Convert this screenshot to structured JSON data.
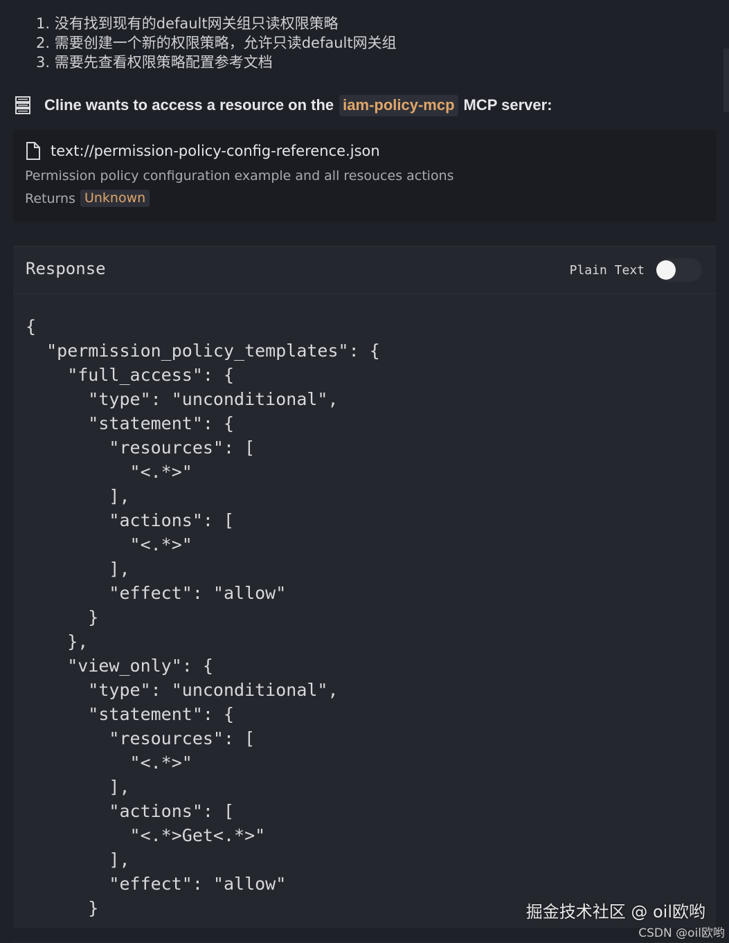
{
  "steps": [
    "1. 没有找到现有的default网关组只读权限策略",
    "2. 需要创建一个新的权限策略，允许只读default网关组",
    "3. 需要先查看权限策略配置参考文档"
  ],
  "access_header": {
    "icon": "server-icon",
    "prefix": "Cline wants to access a resource on the",
    "server_name": "iam-policy-mcp",
    "suffix": "MCP server:"
  },
  "resource": {
    "icon": "file-icon",
    "uri": "text://permission-policy-config-reference.json",
    "description": "Permission policy configuration example and all resouces actions",
    "returns_label": "Returns",
    "returns_value": "Unknown"
  },
  "response": {
    "title": "Response",
    "plain_text_label": "Plain Text",
    "plain_text_enabled": false,
    "code_lines": [
      "{",
      "  \"permission_policy_templates\": {",
      "    \"full_access\": {",
      "      \"type\": \"unconditional\",",
      "      \"statement\": {",
      "        \"resources\": [",
      "          \"<.*>\"",
      "        ],",
      "        \"actions\": [",
      "          \"<.*>\"",
      "        ],",
      "        \"effect\": \"allow\"",
      "      }",
      "    },",
      "    \"view_only\": {",
      "      \"type\": \"unconditional\",",
      "      \"statement\": {",
      "        \"resources\": [",
      "          \"<.*>\"",
      "        ],",
      "        \"actions\": [",
      "          \"<.*>Get<.*>\"",
      "        ],",
      "        \"effect\": \"allow\"",
      "      }",
      "    },"
    ]
  },
  "watermarks": {
    "juejin": "掘金技术社区 @ oil欧哟",
    "csdn": "CSDN @oil欧哟"
  },
  "colors": {
    "background": "#1f2128",
    "card": "#1a1c21",
    "panel": "#25272e",
    "accent": "#e0a66a"
  }
}
